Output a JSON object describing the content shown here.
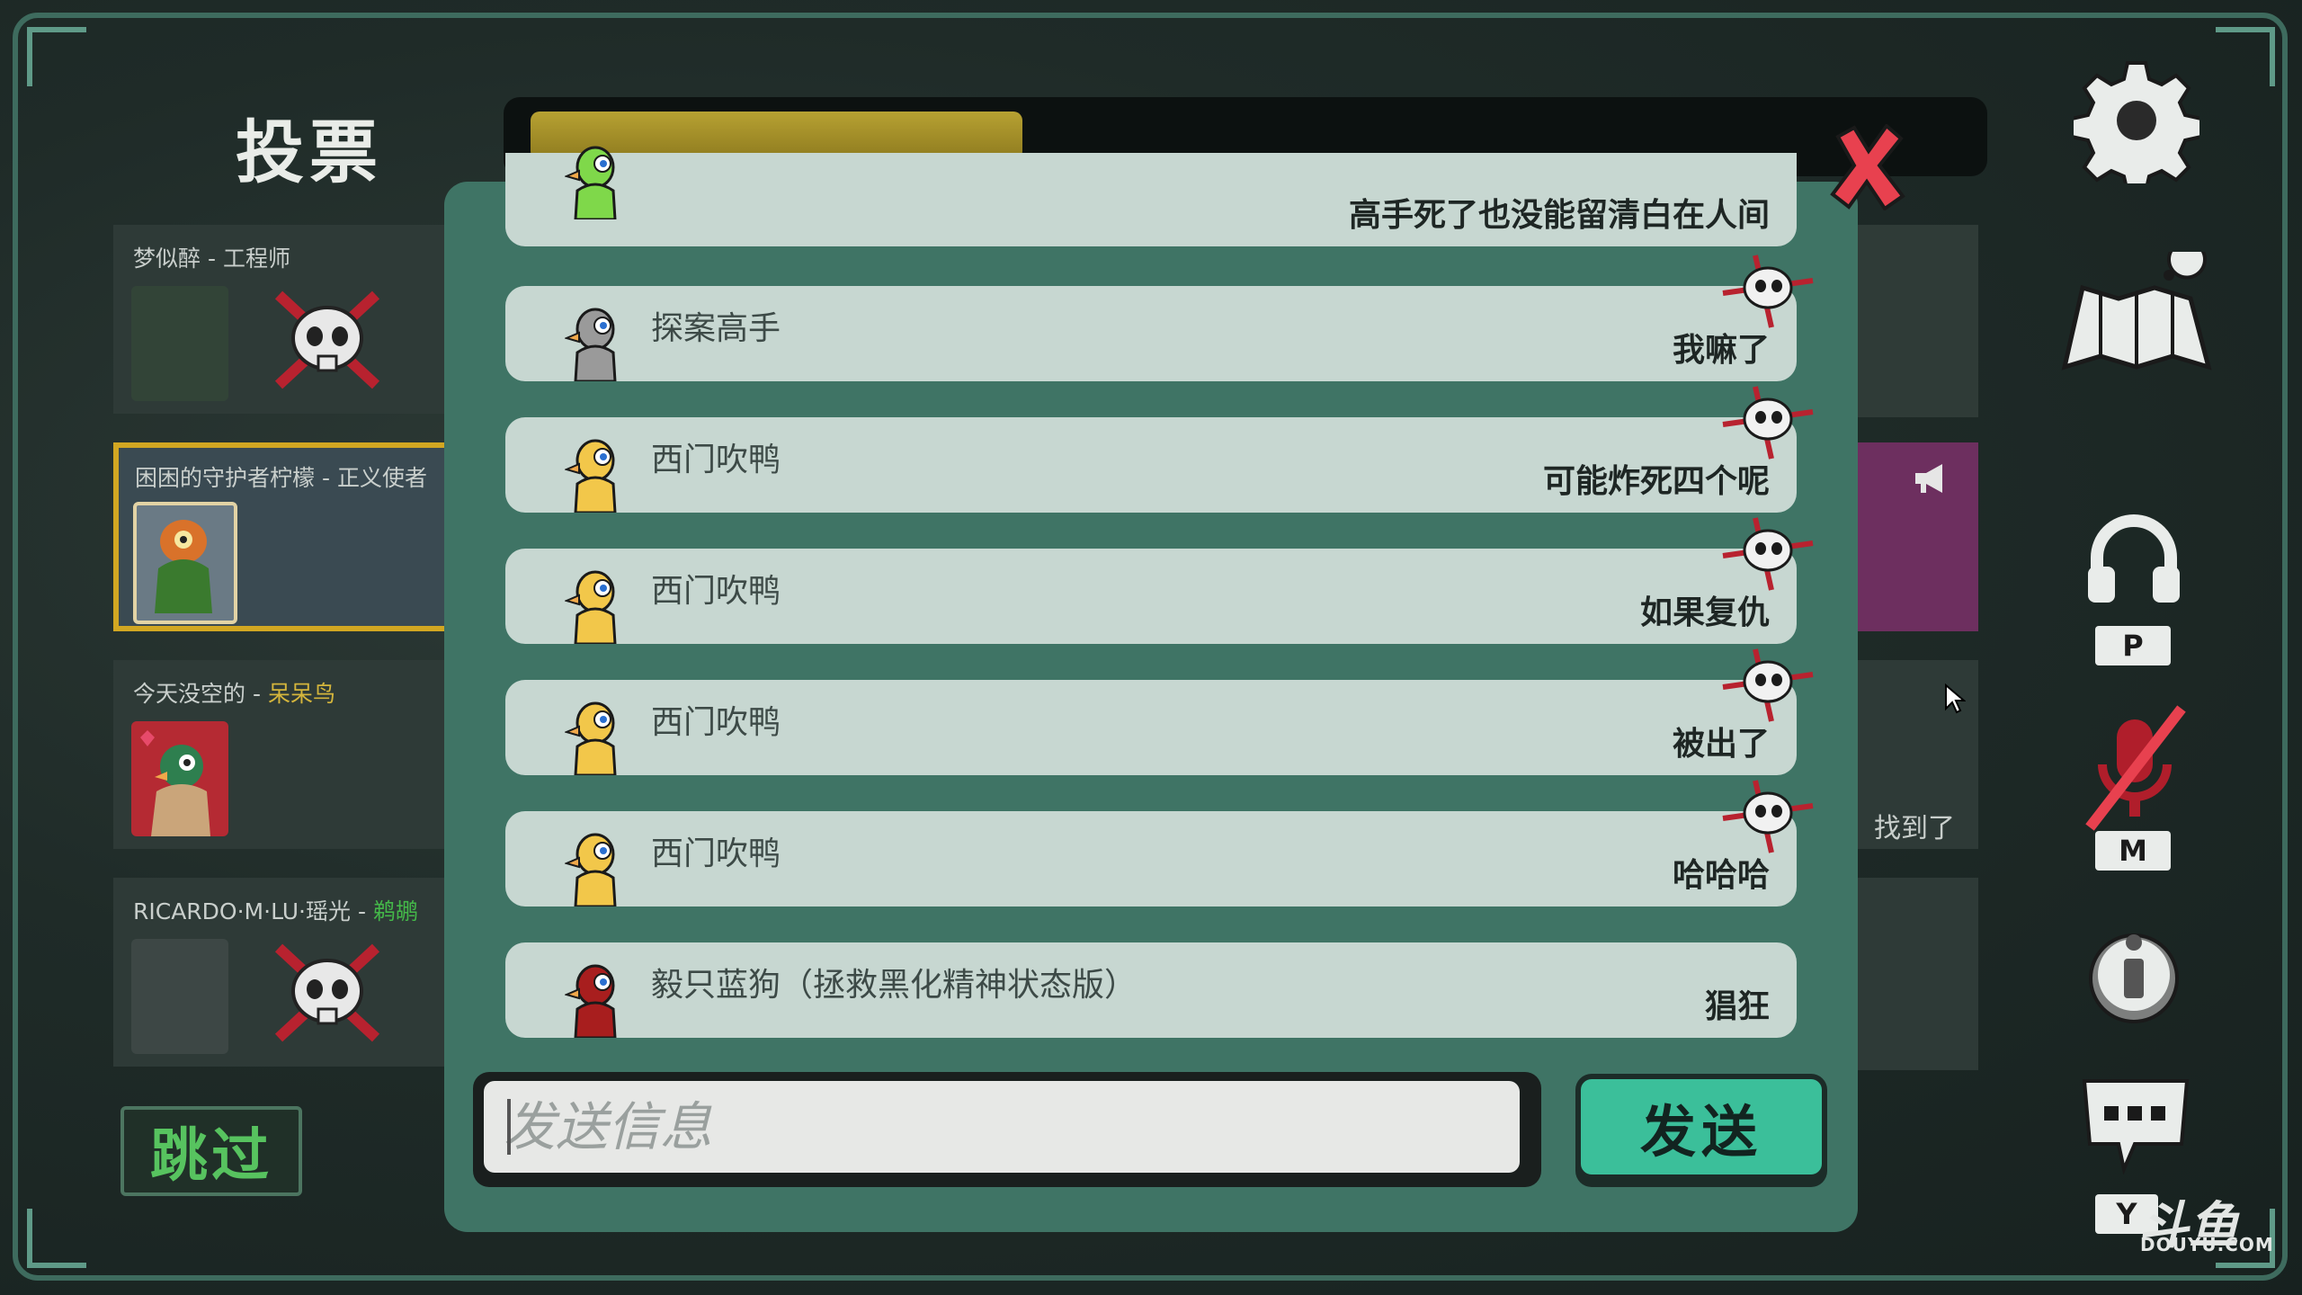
{
  "vote_title": "投票",
  "timer": {
    "progress": 0.34
  },
  "players": [
    {
      "name": "梦似醉",
      "role": "工程师",
      "role_color": "#c9cfcc",
      "dead": true
    },
    {
      "name": "困困的守护者柠檬",
      "role": "正义使者",
      "role_color": "#c9cfcc",
      "dead": false,
      "selected": true
    },
    {
      "name": "今天没空的",
      "role": "呆呆鸟",
      "role_color": "#d4b53c",
      "dead": false
    },
    {
      "name": "RICARDO·M·LU·瑶光",
      "role": "鹈鹕",
      "role_color": "#44b849",
      "dead": true
    }
  ],
  "separator": " - ",
  "skip_label": "跳过",
  "right_slot_text": "找到了",
  "chat": {
    "messages": [
      {
        "sender": "",
        "text": "高手死了也没能留清白在人间",
        "duck_color": "#7fd84a",
        "dead": false
      },
      {
        "sender": "探案高手",
        "text": "我嘛了",
        "duck_color": "#9a9a9a",
        "dead": true
      },
      {
        "sender": "西门吹鸭",
        "text": "可能炸死四个呢",
        "duck_color": "#f2c74a",
        "dead": true
      },
      {
        "sender": "西门吹鸭",
        "text": "如果复仇",
        "duck_color": "#f2c74a",
        "dead": true
      },
      {
        "sender": "西门吹鸭",
        "text": "被出了",
        "duck_color": "#f2c74a",
        "dead": true
      },
      {
        "sender": "西门吹鸭",
        "text": "哈哈哈",
        "duck_color": "#f2c74a",
        "dead": true
      },
      {
        "sender": "毅只蓝狗（拯救黑化精神状态版）",
        "text": "猖狂",
        "duck_color": "#a81e1e",
        "dead": false
      }
    ],
    "input_placeholder": "发送信息",
    "send_label": "发送"
  },
  "side_keys": {
    "voice": "P",
    "mute": "M",
    "chat": "Y"
  },
  "icons": [
    "settings-icon",
    "map-icon",
    "headphones-icon",
    "mic-muted-icon",
    "info-icon",
    "chat-icon",
    "close-icon"
  ],
  "watermark": {
    "logo": "斗鱼",
    "site": "DOUYU.COM"
  }
}
